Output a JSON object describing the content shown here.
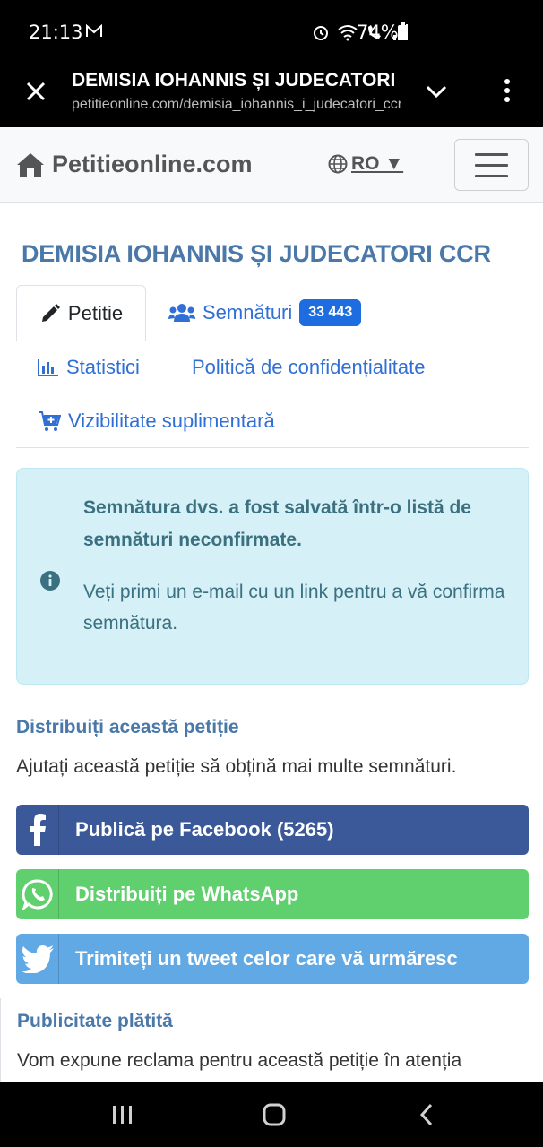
{
  "status": {
    "time": "21:13",
    "battery": "74%"
  },
  "tab": {
    "title": "DEMISIA IOHANNIS ȘI JUDECATORI CCR",
    "url": "petitieonline.com/demisia_iohannis_i_judecatori_ccr"
  },
  "nav": {
    "brand": "Petitieonline.com",
    "lang": "RO ▼"
  },
  "petition": {
    "title": "DEMISIA IOHANNIS ȘI JUDECATORI CCR"
  },
  "tabs": {
    "petitie": "Petitie",
    "semnaturi": "Semnături",
    "semnaturi_count": "33 443",
    "statistici": "Statistici",
    "politica": "Politică de confidențialitate",
    "vizibilitate": "Vizibilitate suplimentară"
  },
  "alert": {
    "strong": "Semnătura dvs. a fost salvată într-o listă de semnături neconfirmate.",
    "message": "Veți primi un e-mail cu un link pentru a vă confirma semnătura."
  },
  "share": {
    "heading": "Distribuiți această petiție",
    "text": "Ajutați această petiție să obțină mai multe semnături.",
    "facebook": "Publică pe Facebook (5265)",
    "whatsapp": "Distribuiți pe WhatsApp",
    "twitter": "Trimiteți un tweet celor care vă urmăresc"
  },
  "paid": {
    "heading": "Publicitate plătită",
    "text": "Vom expune reclama pentru această petiție în atenția"
  },
  "colors": {
    "accent": "#4a78a8",
    "link": "#2f6fd6",
    "facebook": "#3b5998",
    "whatsapp": "#60cf6e",
    "twitter": "#60a9e5"
  }
}
